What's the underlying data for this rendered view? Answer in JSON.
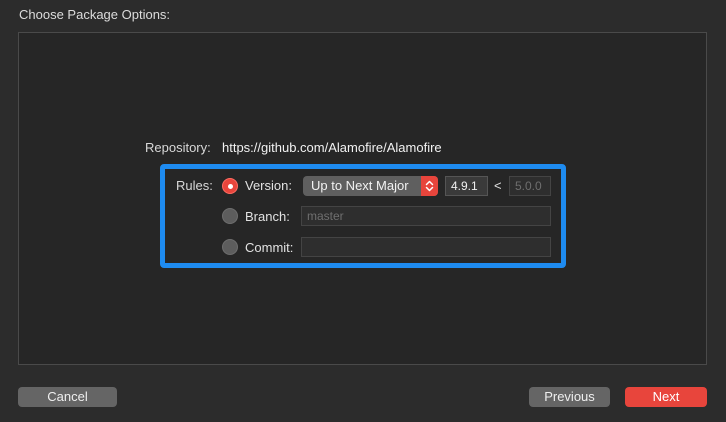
{
  "dialog": {
    "title": "Choose Package Options:"
  },
  "repository": {
    "label": "Repository:",
    "url": "https://github.com/Alamofire/Alamofire"
  },
  "rules": {
    "label": "Rules:",
    "version": {
      "label": "Version:",
      "selected": true,
      "rule_select": "Up to Next Major",
      "from": "4.9.1",
      "separator": "<",
      "to_placeholder": "5.0.0"
    },
    "branch": {
      "label": "Branch:",
      "selected": false,
      "placeholder": "master"
    },
    "commit": {
      "label": "Commit:",
      "selected": false,
      "value": ""
    }
  },
  "buttons": {
    "cancel": "Cancel",
    "previous": "Previous",
    "next": "Next"
  },
  "colors": {
    "accent": "#e8453c",
    "highlight": "#1e8bf0"
  },
  "icons": {
    "stepper": "up-down-chevron-icon"
  }
}
